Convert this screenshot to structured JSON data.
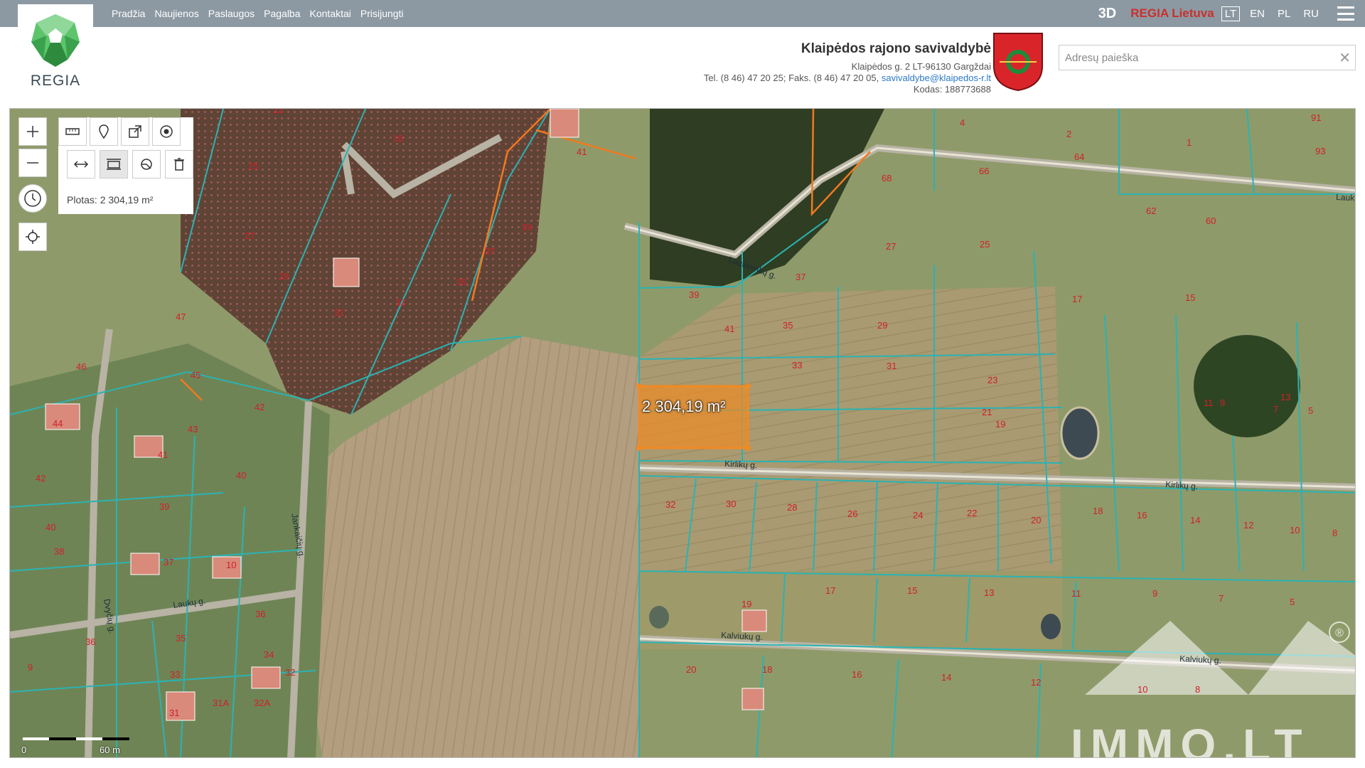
{
  "nav": {
    "items": [
      "Pradžia",
      "Naujienos",
      "Paslaugos",
      "Pagalba",
      "Kontaktai",
      "Prisijungti"
    ]
  },
  "topbar": {
    "btn_3d": "3D",
    "brand": "REGIA Lietuva",
    "languages": [
      "LT",
      "EN",
      "PL",
      "RU"
    ],
    "active_language": "LT"
  },
  "logo": {
    "text": "REGIA"
  },
  "municipality": {
    "name": "Klaipėdos rajono savivaldybė",
    "address": "Klaipėdos g. 2 LT-96130 Gargždai",
    "phone": "Tel. (8 46) 47 20 25; Faks. (8 46) 47 20 05,",
    "email": "savivaldybe@klaipedos-r.lt",
    "code": "Kodas: 188773688"
  },
  "search": {
    "placeholder": "Adresų paieška",
    "value": ""
  },
  "map": {
    "measure_text": "Plotas: 2 304,19 m²",
    "selected_area_label": "2 304,19 m²",
    "scale_start": "0",
    "scale_end": "60 m",
    "watermark": "IMMO.LT",
    "registered_mark": "®",
    "street_names": [
      "Laukininkų g.",
      "Kirlikų g.",
      "Kirlikų g.",
      "Kalviukų g.",
      "Kalviukų g.",
      "Laukų g.",
      "Dvyčių g.",
      "Jankaičių g.",
      "Lauk"
    ],
    "parcel_numbers": [
      "23",
      "18",
      "25",
      "27",
      "29",
      "31",
      "33",
      "35",
      "37",
      "39",
      "41",
      "47",
      "46",
      "45",
      "42",
      "44",
      "43",
      "41",
      "40",
      "42",
      "39",
      "40",
      "38",
      "37",
      "10",
      "36",
      "35",
      "36",
      "34",
      "33",
      "32",
      "31",
      "31A",
      "32A",
      "9",
      "39",
      "37",
      "27",
      "25",
      "41",
      "35",
      "29",
      "23",
      "21",
      "33",
      "31",
      "19",
      "32",
      "30",
      "28",
      "26",
      "24",
      "22",
      "20",
      "18",
      "16",
      "14",
      "12",
      "10",
      "8",
      "17",
      "15",
      "13",
      "11",
      "9",
      "7",
      "5",
      "19",
      "17",
      "15",
      "13",
      "11",
      "9",
      "7",
      "5",
      "20",
      "18",
      "16",
      "14",
      "12",
      "10",
      "8",
      "68",
      "66",
      "64",
      "62",
      "60",
      "4",
      "2",
      "1",
      "91",
      "93"
    ]
  },
  "colors": {
    "topbar": "#8c99a3",
    "parcel_line": "#2ab3b3",
    "selection": "#f08a24",
    "brand_red": "#c9302c",
    "link": "#2a78c8"
  },
  "icons": [
    "zoom-in-icon",
    "zoom-out-icon",
    "ruler-icon",
    "pin-icon",
    "export-icon",
    "target-icon",
    "measure-length-icon",
    "measure-area-icon",
    "measure-angle-icon",
    "trash-icon",
    "clock-icon",
    "locate-icon",
    "hamburger-icon",
    "close-icon"
  ]
}
